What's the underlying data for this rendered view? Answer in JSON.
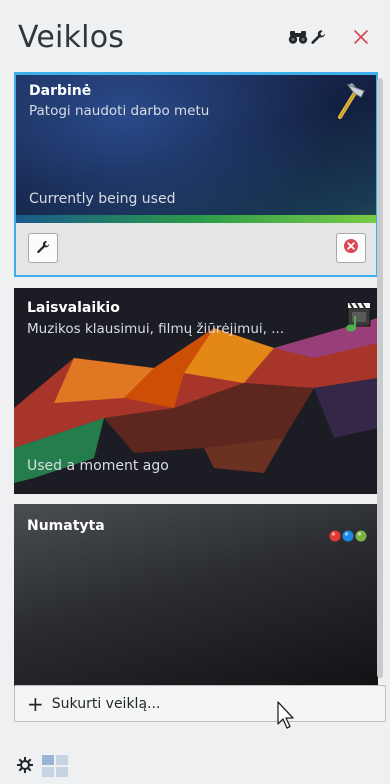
{
  "header": {
    "title": "Veiklos",
    "find_icon": "binoculars-icon",
    "configure_icon": "wrench-icon",
    "close_icon": "close-icon"
  },
  "activities": [
    {
      "name": "Darbinė",
      "description": "Patogi naudoti darbo metu",
      "status": "Currently being used",
      "icon": "hammer-icon",
      "current": true
    },
    {
      "name": "Laisvalaikio",
      "description": "Muzikos klausimui, filmų žiūrėjimui, ...",
      "status": "Used a moment ago",
      "icon": "clapperboard-icon",
      "current": false
    },
    {
      "name": "Numatyta",
      "description": "",
      "status": "",
      "icon": "color-dots-icon",
      "current": false
    }
  ],
  "create": {
    "label": "Sukurti veiklą..."
  },
  "colors": {
    "accent": "#3daee9",
    "stop": "#da4453",
    "panel_bg": "#eff0f1"
  }
}
